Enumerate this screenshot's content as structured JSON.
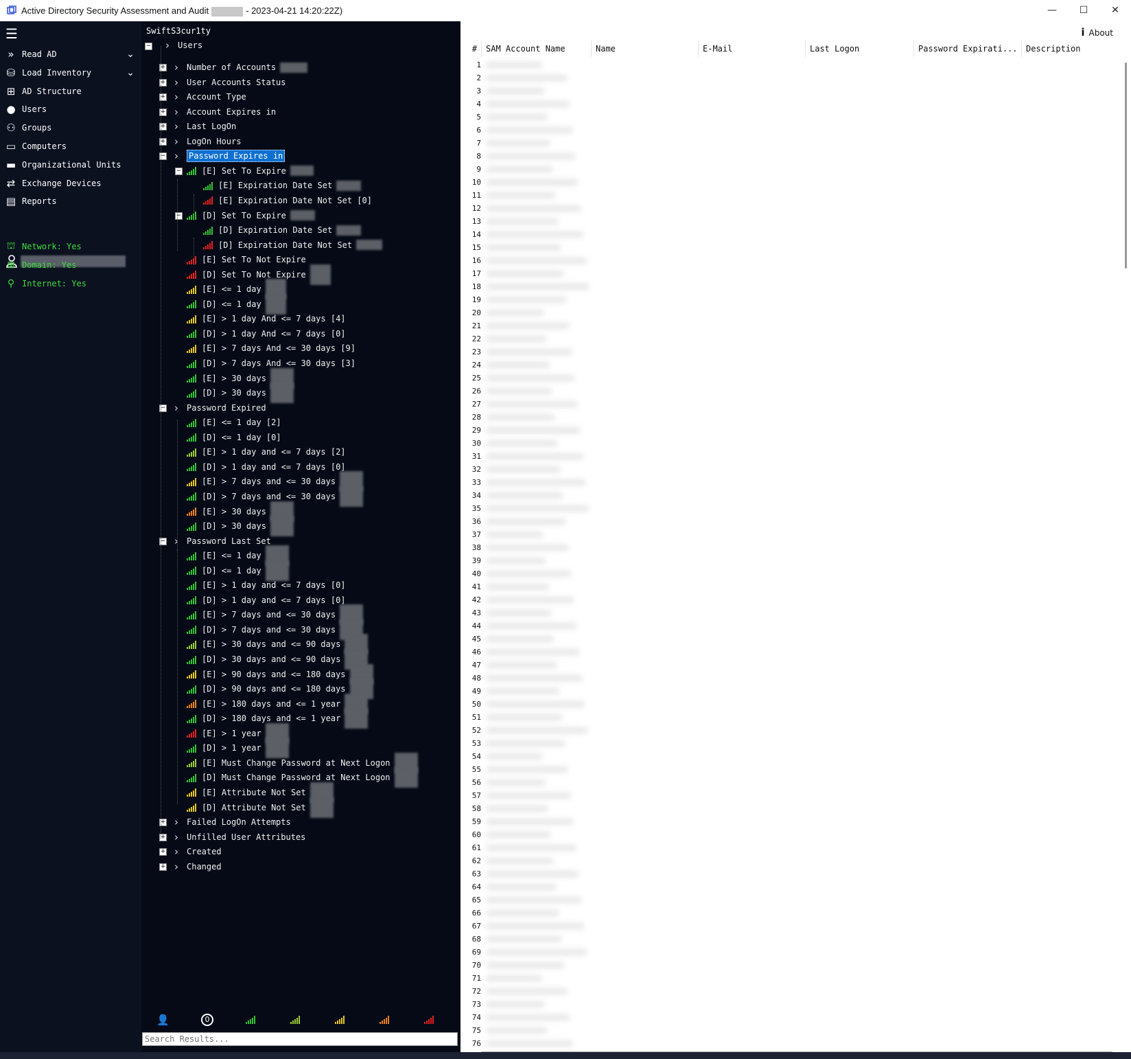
{
  "window": {
    "title_prefix": "Active Directory Security Assessment and Audit",
    "title_suffix": "- 2023-04-21 14:20:22Z)",
    "minimize": "—",
    "maximize": "☐",
    "close": "✕"
  },
  "app_name": "SwiftS3cur1ty",
  "about_label": "About",
  "sidebar": {
    "items": [
      {
        "label": "Read AD",
        "icon": "double-chevron-icon",
        "expandable": true
      },
      {
        "label": "Load Inventory",
        "icon": "database-icon",
        "expandable": true
      },
      {
        "label": "AD Structure",
        "icon": "hierarchy-icon"
      },
      {
        "label": "Users",
        "icon": "user-icon"
      },
      {
        "label": "Groups",
        "icon": "group-icon"
      },
      {
        "label": "Computers",
        "icon": "monitor-icon"
      },
      {
        "label": "Organizational Units",
        "icon": "folder-icon"
      },
      {
        "label": "Exchange Devices",
        "icon": "exchange-icon"
      },
      {
        "label": "Reports",
        "icon": "clipboard-icon"
      }
    ],
    "status": [
      {
        "label": "Network: Yes",
        "icon": "network-icon"
      },
      {
        "label": "Domain: Yes",
        "icon": "domain-icon"
      },
      {
        "label": "Internet: Yes",
        "icon": "internet-icon"
      }
    ],
    "status_color": "#3bdc3b"
  },
  "tree": {
    "root": "Users",
    "nodes": [
      {
        "label": "Number of Accounts",
        "level": 1
      },
      {
        "label": "User Accounts Status",
        "level": 1
      },
      {
        "label": "Account Type",
        "level": 1
      },
      {
        "label": "Account Expires in",
        "level": 1
      },
      {
        "label": "Last LogOn",
        "level": 1
      },
      {
        "label": "LogOn Hours",
        "level": 1
      },
      {
        "label": "Password Expires in",
        "level": 1,
        "selected": true
      },
      {
        "label": "[E] Set To Expire",
        "level": 2,
        "signal": "green"
      },
      {
        "label": "[E] Expiration Date Set",
        "level": 3,
        "signal": "green"
      },
      {
        "label": "[E] Expiration Date Not Set [0]",
        "level": 3,
        "signal": "red"
      },
      {
        "label": "[D] Set To Expire",
        "level": 2,
        "signal": "green"
      },
      {
        "label": "[D] Expiration Date Set",
        "level": 3,
        "signal": "green"
      },
      {
        "label": "[D] Expiration Date Not Set",
        "level": 3,
        "signal": "red"
      },
      {
        "label": "[E] Set To Not Expire",
        "level": 2,
        "signal": "red"
      },
      {
        "label": "[D] Set To Not Expire",
        "level": 2,
        "signal": "red"
      },
      {
        "label": "[E] <= 1 day",
        "level": 2,
        "signal": "yellow"
      },
      {
        "label": "[D] <= 1 day",
        "level": 2,
        "signal": "green"
      },
      {
        "label": "[E] > 1 day And <= 7 days [4]",
        "level": 2,
        "signal": "yellow"
      },
      {
        "label": "[D] > 1 day And <= 7 days [0]",
        "level": 2,
        "signal": "green"
      },
      {
        "label": "[E] > 7 days And <= 30 days [9]",
        "level": 2,
        "signal": "yellow"
      },
      {
        "label": "[D] > 7 days And <= 30 days [3]",
        "level": 2,
        "signal": "green"
      },
      {
        "label": "[E] > 30 days",
        "level": 2,
        "signal": "green"
      },
      {
        "label": "[D] > 30 days",
        "level": 2,
        "signal": "green"
      },
      {
        "label": "Password Expired",
        "level": 1
      },
      {
        "label": "[E] <= 1 day [2]",
        "level": 2,
        "signal": "green"
      },
      {
        "label": "[D] <= 1 day [0]",
        "level": 2,
        "signal": "green"
      },
      {
        "label": "[E] > 1 day and <= 7 days [2]",
        "level": 2,
        "signal": "yellowgreen"
      },
      {
        "label": "[D] > 1 day and <= 7 days [0]",
        "level": 2,
        "signal": "green"
      },
      {
        "label": "[E] > 7 days and <= 30 days",
        "level": 2,
        "signal": "yellow"
      },
      {
        "label": "[D] > 7 days and <= 30 days",
        "level": 2,
        "signal": "green"
      },
      {
        "label": "[E] > 30 days",
        "level": 2,
        "signal": "orange"
      },
      {
        "label": "[D] > 30 days",
        "level": 2,
        "signal": "green"
      },
      {
        "label": "Password Last Set",
        "level": 1
      },
      {
        "label": "[E] <= 1 day",
        "level": 2,
        "signal": "green"
      },
      {
        "label": "[D] <= 1 day",
        "level": 2,
        "signal": "green"
      },
      {
        "label": "[E] > 1 day and <= 7 days [0]",
        "level": 2,
        "signal": "green"
      },
      {
        "label": "[D] > 1 day and <= 7 days [0]",
        "level": 2,
        "signal": "green"
      },
      {
        "label": "[E] > 7 days and <= 30 days",
        "level": 2,
        "signal": "green"
      },
      {
        "label": "[D] > 7 days and <= 30 days",
        "level": 2,
        "signal": "green"
      },
      {
        "label": "[E] > 30 days and <= 90 days",
        "level": 2,
        "signal": "yellowgreen"
      },
      {
        "label": "[D] > 30 days and <= 90 days",
        "level": 2,
        "signal": "green"
      },
      {
        "label": "[E] > 90 days and <= 180 days",
        "level": 2,
        "signal": "yellow"
      },
      {
        "label": "[D] > 90 days and <= 180 days",
        "level": 2,
        "signal": "green"
      },
      {
        "label": "[E] > 180 days and <= 1 year",
        "level": 2,
        "signal": "orange"
      },
      {
        "label": "[D] > 180 days and <= 1 year",
        "level": 2,
        "signal": "green"
      },
      {
        "label": "[E] > 1 year",
        "level": 2,
        "signal": "red"
      },
      {
        "label": "[D] > 1 year",
        "level": 2,
        "signal": "green"
      },
      {
        "label": "[E] Must Change Password at Next Logon",
        "level": 2,
        "signal": "yellowgreen"
      },
      {
        "label": "[D] Must Change Password at Next Logon",
        "level": 2,
        "signal": "green"
      },
      {
        "label": "[E] Attribute Not Set",
        "level": 2,
        "signal": "yellow"
      },
      {
        "label": "[D] Attribute Not Set",
        "level": 2,
        "signal": "yellow"
      },
      {
        "label": "Failed LogOn Attempts",
        "level": 1
      },
      {
        "label": "Unfilled User Attributes",
        "level": 1
      },
      {
        "label": "Created",
        "level": 1
      },
      {
        "label": "Changed",
        "level": 1
      }
    ]
  },
  "signal_colors": {
    "green": "#33c433",
    "yellowgreen": "#9acd32",
    "yellow": "#e6c619",
    "orange": "#ef7f1a",
    "red": "#e32020"
  },
  "bottom_filters": [
    "remove-user-icon",
    "zero-icon",
    "signal-green-icon",
    "signal-yellowgreen-icon",
    "signal-yellow-icon",
    "signal-orange-icon",
    "signal-red-icon"
  ],
  "zero_label": "0",
  "search_placeholder": "Search Results...",
  "grid": {
    "columns": [
      "#",
      "SAM Account Name",
      "Name",
      "E-Mail",
      "Last Logon",
      "Password Expirati...",
      "Description"
    ],
    "row_count": 76
  }
}
